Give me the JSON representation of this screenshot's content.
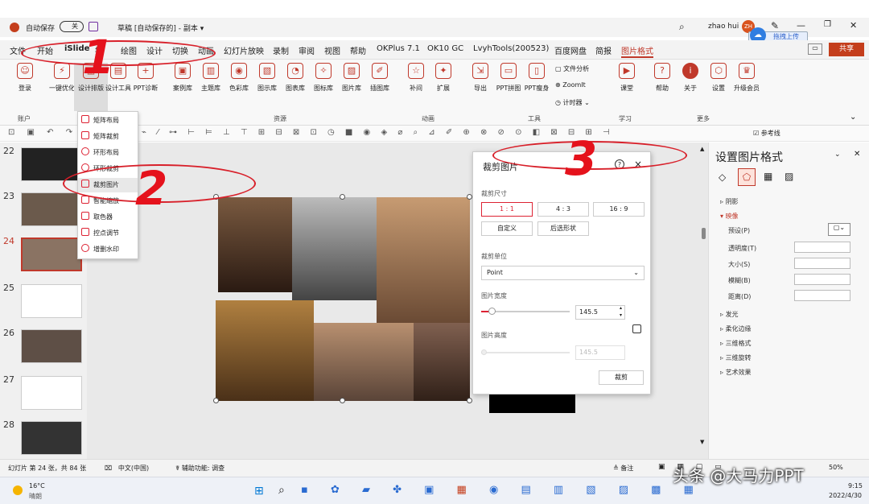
{
  "titlebar": {
    "autosave": "自动保存",
    "autosave_state": "关",
    "doc_title": "草稿 [自动保存的] - 副本 ▾",
    "user": "zhao hui",
    "user_initials": "ZH",
    "upload": "拖拽上传"
  },
  "tabs": [
    "文件",
    "开始",
    "iSlide",
    "插",
    "绘图",
    "设计",
    "切换",
    "动画",
    "幻灯片放映",
    "录制",
    "审阅",
    "视图",
    "帮助",
    "OKPlus 7.1",
    "OK10 GC",
    "LvyhTools(200523)",
    "百度网盘",
    "简报",
    "图片格式"
  ],
  "share": "共享",
  "ribbon": {
    "buttons": [
      "登录",
      "一键优化",
      "设计排版",
      "设计工具",
      "PPT诊断",
      "案例库",
      "主题库",
      "色彩库",
      "图示库",
      "图表库",
      "图标库",
      "图片库",
      "插图库",
      "补间",
      "扩展",
      "导出",
      "PPT拼图",
      "PPT瘦身",
      "课堂",
      "帮助",
      "关于",
      "设置",
      "升级会员"
    ],
    "right_small": [
      "文件分析",
      "ZoomIt",
      "计时器"
    ],
    "groups": [
      "账户",
      "资源",
      "动画",
      "工具",
      "学习",
      "更多"
    ]
  },
  "toolbar2": {
    "ref_line": "参考线"
  },
  "dropdown": [
    "矩阵布局",
    "矩阵裁剪",
    "环形布局",
    "环形裁剪",
    "裁剪图片",
    "智能缩放",
    "取色器",
    "控点调节",
    "增删水印"
  ],
  "thumbnails": [
    22,
    23,
    24,
    25,
    26,
    27,
    28
  ],
  "crop_panel": {
    "title": "裁剪图片",
    "help": "?",
    "close": "×",
    "size_label": "裁剪尺寸",
    "ratios": [
      "1 : 1",
      "4 : 3",
      "16 : 9"
    ],
    "custom": "自定义",
    "post_shape": "后选形状",
    "unit_label": "裁剪单位",
    "unit": "Point",
    "width_label": "图片宽度",
    "width_value": "145.5",
    "height_label": "图片高度",
    "height_value": "145.5",
    "apply": "裁剪"
  },
  "format_pane": {
    "title": "设置图片格式",
    "sections": [
      "阴影",
      "映像",
      "发光",
      "柔化边缘",
      "三维格式",
      "三维旋转",
      "艺术效果"
    ],
    "rows": [
      "预设(P)",
      "透明度(T)",
      "大小(S)",
      "模糊(B)",
      "距离(D)"
    ]
  },
  "status": {
    "slide": "幻灯片 第 24 张，共 84 张",
    "lang": "中文(中国)",
    "access": "辅助功能: 调查",
    "notes": "备注",
    "zoom": "50%"
  },
  "taskbar": {
    "temp": "16°C",
    "weather": "晴朗",
    "time": "9:15",
    "date": "2022/4/30"
  },
  "watermark": "头条 @大马力PPT",
  "annotations": [
    "1",
    "2",
    "3"
  ],
  "colors": {
    "accent": "#c0392b",
    "annotation": "#e5121c"
  }
}
